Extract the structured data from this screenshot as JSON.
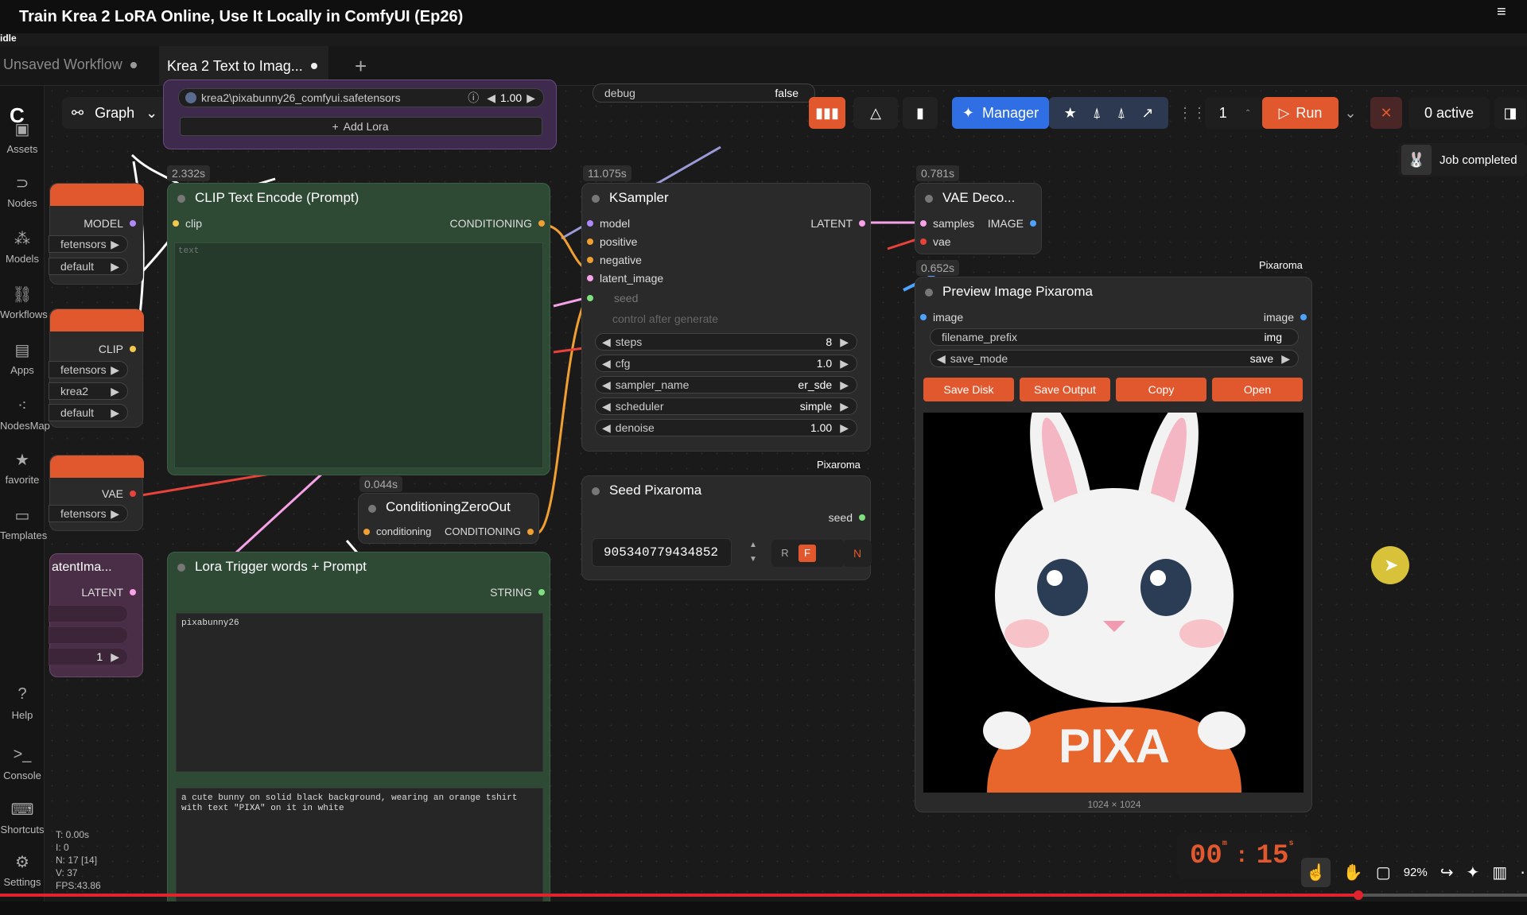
{
  "video": {
    "title": "Train Krea 2 LoRA Online, Use It Locally in ComfyUI (Ep26)",
    "status": "idle",
    "timer_min": "00",
    "timer_sec": "15",
    "timer_min_unit": "m",
    "timer_sec_unit": "s",
    "zoom": "92%"
  },
  "tabs": [
    {
      "label": "Unsaved Workflow"
    },
    {
      "label": "Krea 2 Text to Imag..."
    }
  ],
  "graph": {
    "label": "Graph"
  },
  "sidebar": [
    {
      "label": "Assets"
    },
    {
      "label": "Nodes"
    },
    {
      "label": "Models"
    },
    {
      "label": "Workflows"
    },
    {
      "label": "Apps"
    },
    {
      "label": "NodesMap"
    },
    {
      "label": "favorite"
    },
    {
      "label": "Templates"
    },
    {
      "label": "Help"
    },
    {
      "label": "Console"
    },
    {
      "label": "Shortcuts"
    },
    {
      "label": "Settings"
    }
  ],
  "toolbar": {
    "manager": "Manager",
    "batch": "1",
    "run": "Run",
    "active": "0 active",
    "job": "Job completed"
  },
  "stats": {
    "t": "T: 0.00s",
    "i": "I: 0",
    "n": "N: 17 [14]",
    "v": "V: 37",
    "fps": "FPS:43.86"
  },
  "lora": {
    "file": "krea2\\pixabunny26_comfyui.safetensors",
    "strength": "1.00",
    "add": "Add Lora"
  },
  "debug": {
    "label": "debug",
    "value": "false"
  },
  "left_nodes": {
    "model": "MODEL",
    "clip": "CLIP",
    "vae": "VAE",
    "latent": "LATENT",
    "row_safetensors": "fetensors",
    "row_default": "default",
    "row_krea2": "krea2",
    "latent_title": "atentIma...",
    "latent_count": "1"
  },
  "clip_node": {
    "time": "2.332s",
    "title": "CLIP Text Encode (Prompt)",
    "in": "clip",
    "out": "CONDITIONING",
    "placeholder": "text"
  },
  "ksampler": {
    "time": "11.075s",
    "title": "KSampler",
    "inputs": [
      "model",
      "positive",
      "negative",
      "latent_image"
    ],
    "out": "LATENT",
    "seed": "seed",
    "control": "control after generate",
    "widgets": [
      {
        "label": "steps",
        "value": "8"
      },
      {
        "label": "cfg",
        "value": "1.0"
      },
      {
        "label": "sampler_name",
        "value": "er_sde"
      },
      {
        "label": "scheduler",
        "value": "simple"
      },
      {
        "label": "denoise",
        "value": "1.00"
      }
    ],
    "brand": "Pixaroma"
  },
  "vae_decode": {
    "time": "0.781s",
    "title": "VAE Deco...",
    "in_samples": "samples",
    "in_vae": "vae",
    "out": "IMAGE"
  },
  "preview": {
    "time": "0.652s",
    "brand": "Pixaroma",
    "title": "Preview Image Pixaroma",
    "in": "image",
    "out": "image",
    "filename_label": "filename_prefix",
    "filename_value": "img",
    "save_label": "save_mode",
    "save_value": "save",
    "buttons": [
      "Save Disk",
      "Save Output",
      "Copy",
      "Open"
    ],
    "size": "1024 × 1024",
    "shirt_text": "PIXA"
  },
  "czo": {
    "time": "0.044s",
    "title": "ConditioningZeroOut",
    "in": "conditioning",
    "out": "CONDITIONING"
  },
  "seed_node": {
    "title": "Seed Pixaroma",
    "out": "seed",
    "value": "905340779434852",
    "r": "R",
    "f": "F",
    "n": "N"
  },
  "lora_prompt": {
    "title": "Lora Trigger words + Prompt",
    "out": "STRING",
    "text1": "pixabunny26",
    "text2": "a cute bunny on solid black background, wearing an orange tshirt with text \"PIXA\" on it in white"
  },
  "colors": {
    "accent": "#e2582e",
    "manager": "#2f6fe3",
    "clip_node": "#2e4a35",
    "latent_node": "#4a2e47"
  }
}
